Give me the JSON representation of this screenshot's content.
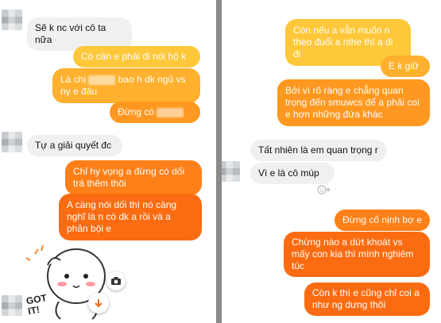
{
  "left": {
    "messages": [
      {
        "text": "Sẽ k nc với cô ta nữa"
      },
      {
        "text": "Có cần e phải đi nói hộ k"
      },
      {
        "text_a": "Là chị",
        "text_b": "bao h dk ngủ vs ny e đâu"
      },
      {
        "text": "Đừng có"
      },
      {
        "text": "Tự a giải quyết đc"
      },
      {
        "text": "Chỉ hy vọng a đừng có dối trá thêm thôi"
      },
      {
        "text": "A càng nói dối thì nó càng nghĩ là n có dk a rồi và a phản bội e"
      }
    ],
    "sticker_text": "GOT IT!"
  },
  "right": {
    "messages": [
      {
        "text": "Còn nếu a vẫn muốn n theo đuổi a nthe thì a đi đi"
      },
      {
        "text": "E k giữ"
      },
      {
        "text": "Bởi vì rõ ràng e chẳng quan trọng đến smuwcs để a phải coi e hơn những đứa khác"
      },
      {
        "text": "Tất nhiên là em quan trọng r"
      },
      {
        "text": "Vì e là cô múp"
      },
      {
        "text": "Đừng cố nịnh bợ e"
      },
      {
        "text": "Chừng nào a dứt khoát vs mấy con kia thì mình nghiêm túc"
      },
      {
        "text": "Còn k thì e cũng chỉ coi a như ng dưng thôi"
      }
    ]
  }
}
